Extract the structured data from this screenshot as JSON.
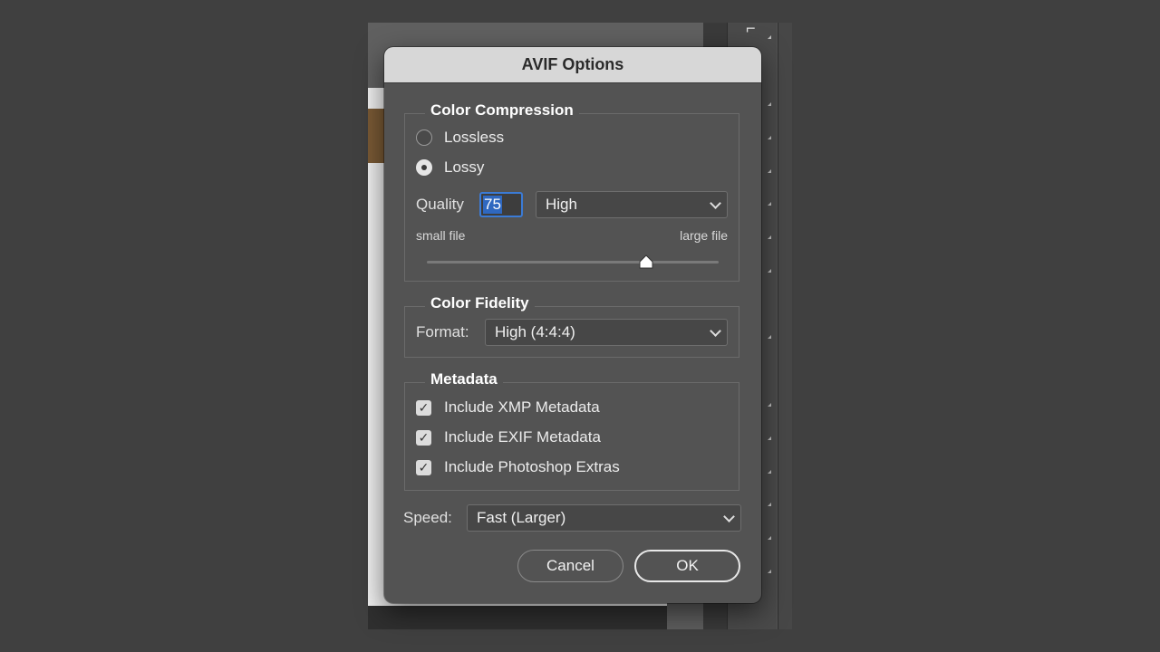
{
  "dialog": {
    "title": "AVIF Options"
  },
  "color_compression": {
    "title": "Color Compression",
    "options": [
      {
        "label": "Lossless",
        "selected": false
      },
      {
        "label": "Lossy",
        "selected": true
      }
    ],
    "quality_label": "Quality",
    "quality_value": "75",
    "quality_preset": "High",
    "slider_min_label": "small file",
    "slider_max_label": "large file",
    "slider_value": 75
  },
  "color_fidelity": {
    "title": "Color Fidelity",
    "format_label": "Format:",
    "format_value": "High (4:4:4)"
  },
  "metadata": {
    "title": "Metadata",
    "items": [
      {
        "label": "Include XMP Metadata",
        "checked": true
      },
      {
        "label": "Include EXIF Metadata",
        "checked": true
      },
      {
        "label": "Include Photoshop Extras",
        "checked": true
      }
    ]
  },
  "speed": {
    "label": "Speed:",
    "value": "Fast (Larger)"
  },
  "buttons": {
    "cancel": "Cancel",
    "ok": "OK"
  },
  "colors": {
    "accent": "#2f68c0",
    "dialog_bg": "#535353",
    "titlebar_bg": "#d7d7d7"
  },
  "icons": {
    "select_chevron": "chevron-down-icon",
    "check": "checkmark-icon"
  }
}
